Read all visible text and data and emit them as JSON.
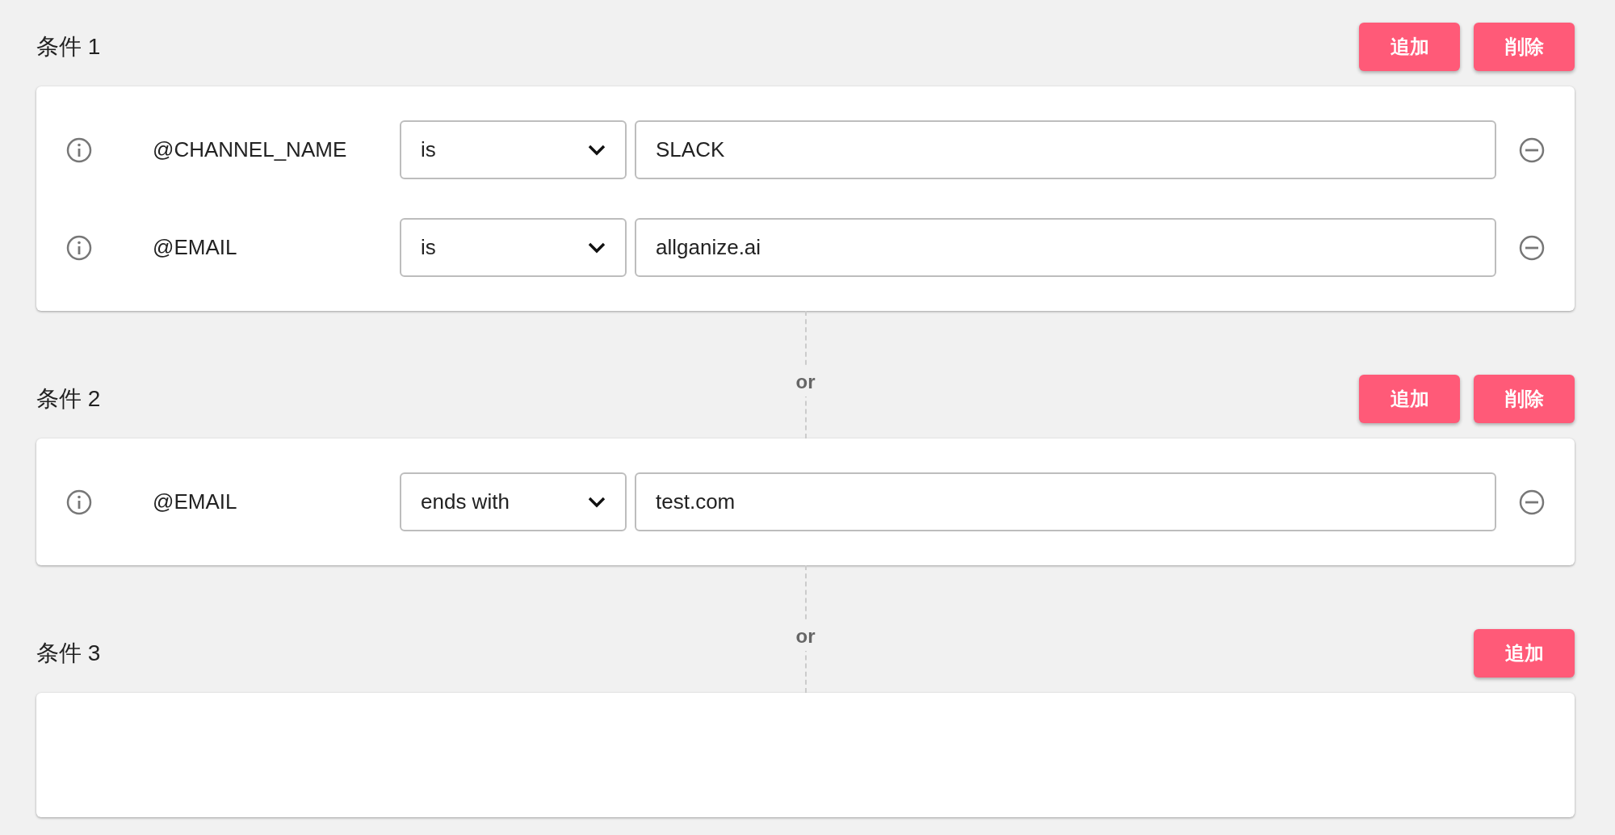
{
  "groups": [
    {
      "title": "条件 1",
      "buttons": [
        "追加",
        "削除"
      ],
      "conditions": [
        {
          "variable": "@CHANNEL_NAME",
          "operator": "is",
          "value": "SLACK"
        },
        {
          "variable": "@EMAIL",
          "operator": "is",
          "value": "allganize.ai"
        }
      ]
    },
    {
      "connector": "or",
      "title": "条件 2",
      "buttons": [
        "追加",
        "削除"
      ],
      "conditions": [
        {
          "variable": "@EMAIL",
          "operator": "ends with",
          "value": "test.com"
        }
      ]
    },
    {
      "connector": "or",
      "title": "条件 3",
      "buttons": [
        "追加"
      ]
    }
  ]
}
